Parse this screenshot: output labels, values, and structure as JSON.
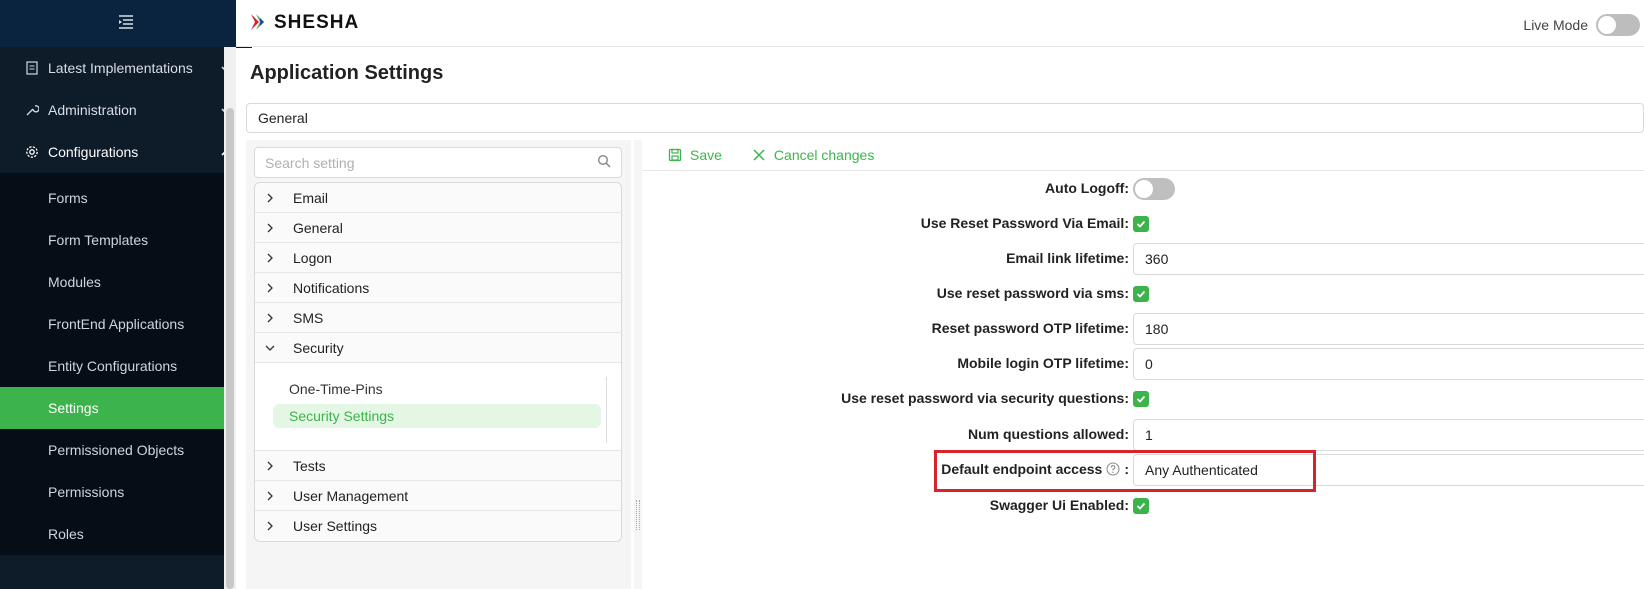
{
  "header": {
    "brand": "SHESHA",
    "live_mode_label": "Live Mode"
  },
  "sidebar": {
    "top_items": [
      {
        "label": "Latest Implementations",
        "icon": "document-icon"
      },
      {
        "label": "Administration",
        "icon": "wrench-icon"
      },
      {
        "label": "Configurations",
        "icon": "gear-icon"
      }
    ],
    "sub_items": [
      {
        "label": "Forms"
      },
      {
        "label": "Form Templates"
      },
      {
        "label": "Modules"
      },
      {
        "label": "FrontEnd Applications"
      },
      {
        "label": "Entity Configurations"
      },
      {
        "label": "Settings"
      },
      {
        "label": "Permissioned Objects"
      },
      {
        "label": "Permissions"
      },
      {
        "label": "Roles"
      }
    ],
    "active_color": "#3cb44b"
  },
  "main": {
    "title": "Application Settings",
    "app_select": "General",
    "search_placeholder": "Search setting",
    "tree": {
      "groups_before": [
        "Email",
        "General",
        "Logon",
        "Notifications",
        "SMS"
      ],
      "expanded_group": "Security",
      "children": [
        "One-Time-Pins",
        "Security Settings"
      ],
      "groups_after": [
        "Tests",
        "User Management",
        "User Settings"
      ]
    },
    "toolbar": {
      "save_label": "Save",
      "cancel_label": "Cancel changes"
    },
    "form": {
      "auto_logoff_label": "Auto Logoff",
      "reset_email_label": "Use Reset Password Via Email",
      "email_link_label": "Email link lifetime",
      "email_link_value": "360",
      "reset_sms_label": "Use reset password via sms",
      "otp_lifetime_label": "Reset password OTP lifetime",
      "otp_lifetime_value": "180",
      "mobile_otp_label": "Mobile login OTP lifetime",
      "mobile_otp_value": "0",
      "reset_questions_label": "Use reset password via security questions",
      "num_questions_label": "Num questions allowed",
      "num_questions_value": "1",
      "default_access_label": "Default endpoint access",
      "default_access_value": "Any Authenticated",
      "swagger_label": "Swagger Ui Enabled"
    }
  }
}
